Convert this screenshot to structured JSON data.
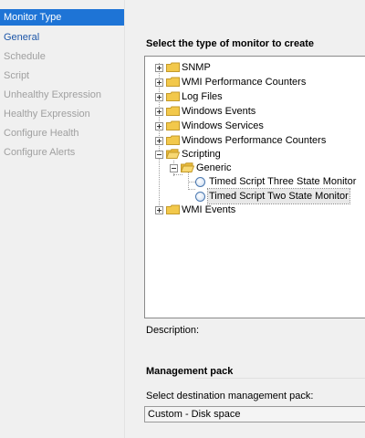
{
  "nav": {
    "items": [
      {
        "label": "Monitor Type",
        "state": "active"
      },
      {
        "label": "General",
        "state": "link"
      },
      {
        "label": "Schedule",
        "state": "disabled"
      },
      {
        "label": "Script",
        "state": "disabled"
      },
      {
        "label": "Unhealthy Expression",
        "state": "disabled"
      },
      {
        "label": "Healthy Expression",
        "state": "disabled"
      },
      {
        "label": "Configure Health",
        "state": "disabled"
      },
      {
        "label": "Configure Alerts",
        "state": "disabled"
      }
    ]
  },
  "main": {
    "select_title": "Select the type of monitor to create",
    "tree": {
      "snmp": "SNMP",
      "wmi_perf": "WMI Performance Counters",
      "log_files": "Log Files",
      "win_events": "Windows Events",
      "win_services": "Windows Services",
      "win_perf": "Windows Performance Counters",
      "scripting": "Scripting",
      "generic": "Generic",
      "three_state": "Timed Script Three State Monitor",
      "two_state": "Timed Script Two State Monitor",
      "wmi_events": "WMI Events"
    },
    "description_label": "Description:",
    "management_pack_title": "Management pack",
    "select_mp_label": "Select destination management pack:",
    "mp_value": "Custom - Disk space"
  },
  "colors": {
    "selected_nav_bg": "#1e74d6",
    "link_text": "#1d56a8",
    "disabled_text": "#a0a0a0",
    "folder": "#f2c84b"
  }
}
